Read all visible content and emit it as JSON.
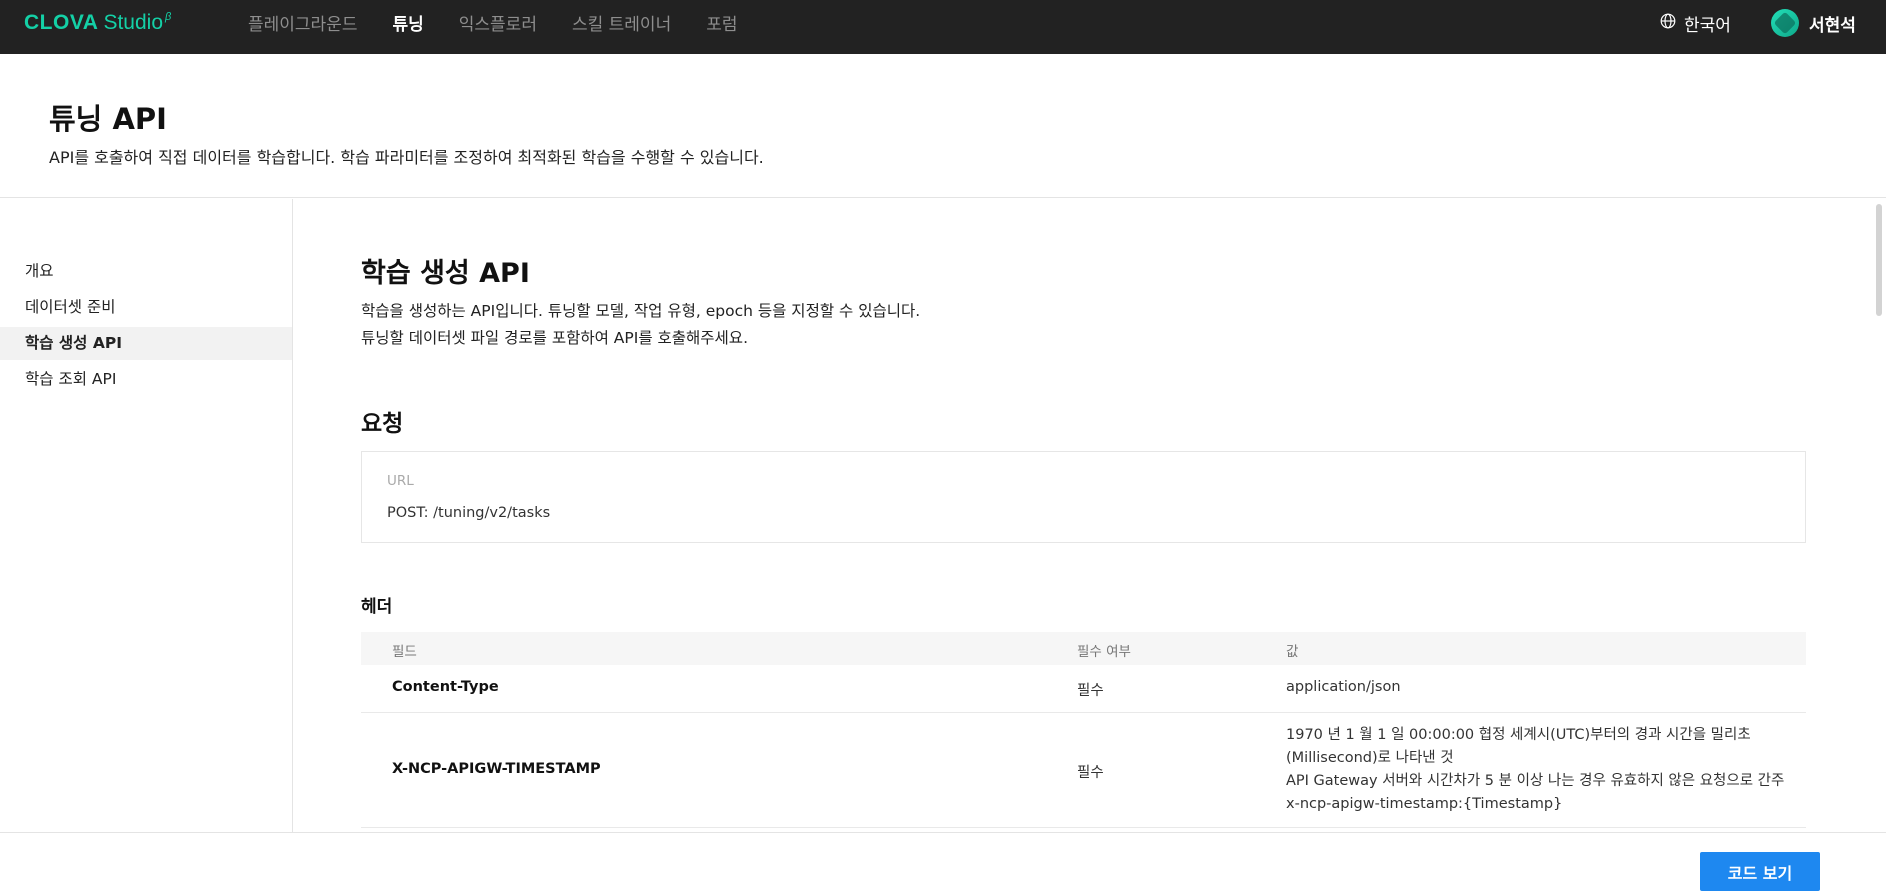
{
  "brand": {
    "name": "CLOVA",
    "product": "Studio",
    "beta": "β",
    "accent": "#14d0a6"
  },
  "nav": {
    "items": [
      {
        "label": "플레이그라운드",
        "active": false
      },
      {
        "label": "튜닝",
        "active": true
      },
      {
        "label": "익스플로러",
        "active": false
      },
      {
        "label": "스킬 트레이너",
        "active": false
      },
      {
        "label": "포럼",
        "active": false
      }
    ],
    "language": "한국어",
    "user_name": "서현석"
  },
  "page": {
    "title": "튜닝 API",
    "description": "API를 호출하여 직접 데이터를 학습합니다. 학습 파라미터를 조정하여 최적화된 학습을 수행할 수 있습니다."
  },
  "sidebar": {
    "items": [
      {
        "label": "개요",
        "active": false
      },
      {
        "label": "데이터셋 준비",
        "active": false
      },
      {
        "label": "학습 생성 API",
        "active": true
      },
      {
        "label": "학습 조회 API",
        "active": false
      }
    ]
  },
  "main": {
    "section_title": "학습 생성 API",
    "section_desc_1": "학습을 생성하는 API입니다. 튜닝할 모델, 작업 유형, epoch 등을 지정할 수 있습니다.",
    "section_desc_2": "튜닝할 데이터셋 파일 경로를 포함하여 API를 호출해주세요.",
    "request_title": "요청",
    "url_label": "URL",
    "url_value": "POST: /tuning/v2/tasks",
    "header_title": "헤더",
    "table": {
      "columns": [
        "필드",
        "필수 여부",
        "값"
      ],
      "rows": [
        {
          "field": "Content-Type",
          "required": "필수",
          "values": [
            "application/json"
          ]
        },
        {
          "field": "X-NCP-APIGW-TIMESTAMP",
          "required": "필수",
          "values": [
            "1970 년 1 월 1 일 00:00:00 협정 세계시(UTC)부터의 경과 시간을 밀리초",
            "(Millisecond)로 나타낸 것",
            "API Gateway 서버와 시간차가 5 분 이상 나는 경우 유효하지 않은 요청으로 간주",
            "x-ncp-apigw-timestamp:{Timestamp}"
          ]
        }
      ]
    }
  },
  "footer": {
    "code_button": "코드 보기",
    "button_color": "#1e88f0"
  }
}
